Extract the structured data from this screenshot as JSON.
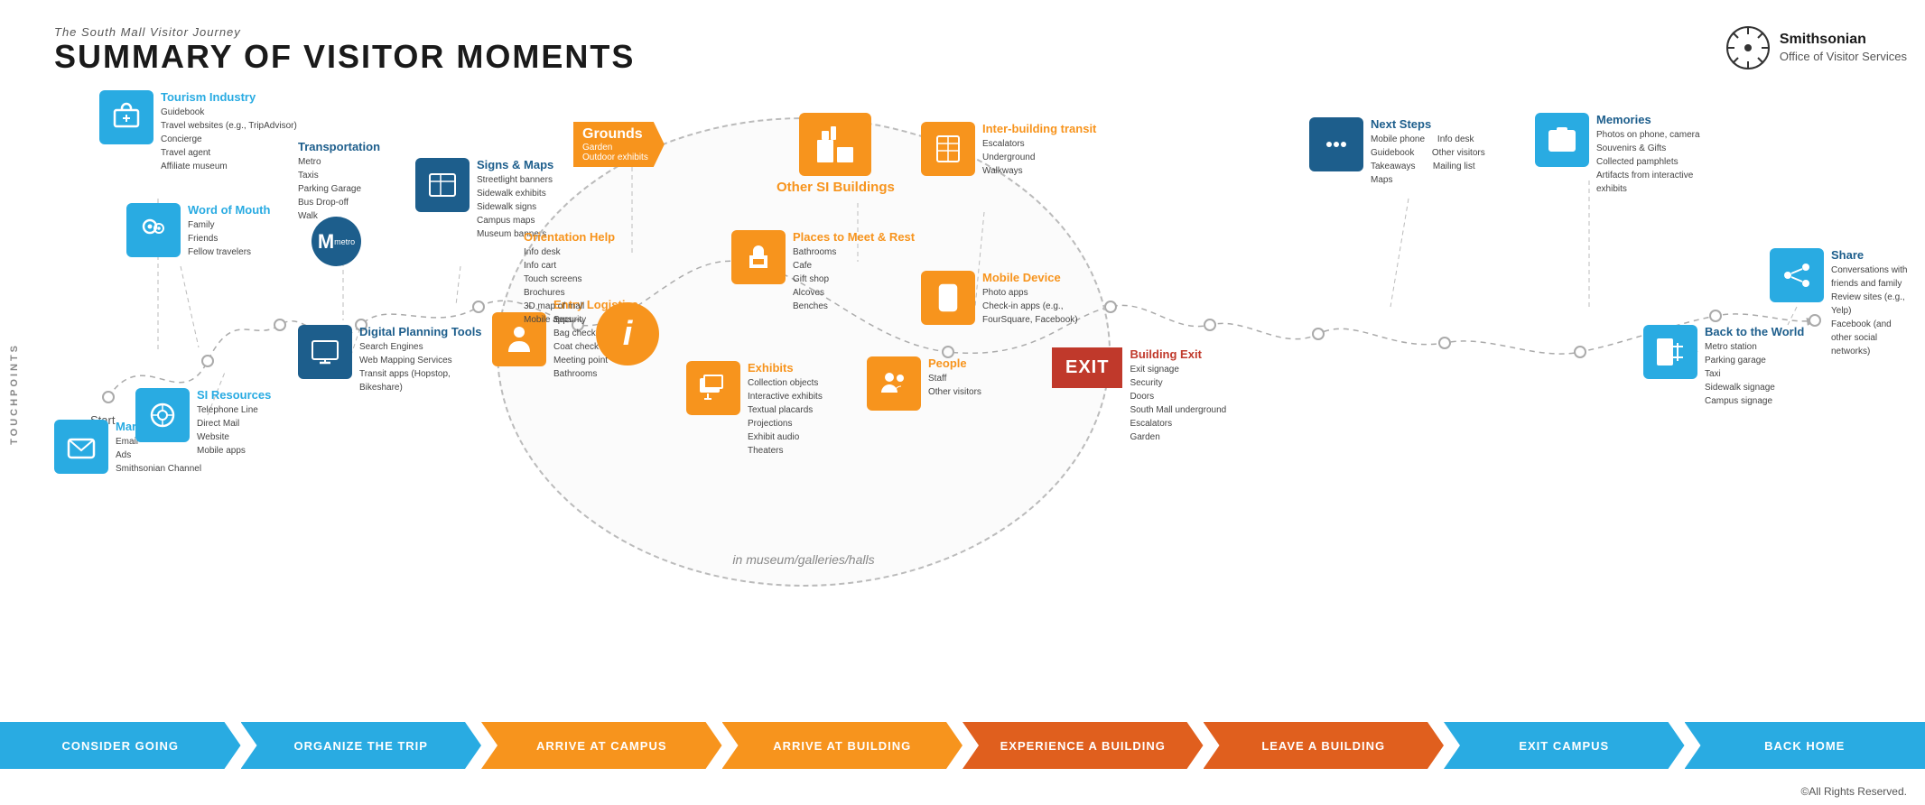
{
  "header": {
    "subtitle": "The South Mall Visitor Journey",
    "title": "SUMMARY OF VISITOR MOMENTS"
  },
  "smithsonian": {
    "name": "Smithsonian",
    "dept": "Office of Visitor Services"
  },
  "copyright": "©All Rights Reserved.",
  "touchpoints_label": "TOUCHPOINTS",
  "central_label": "in museum/galleries/halls",
  "boxes": {
    "tourism": {
      "title": "Tourism Industry",
      "items": [
        "Guidebook",
        "Travel websites (e.g., TripAdvisor)",
        "Concierge",
        "Travel agent",
        "Affiliate museum"
      ]
    },
    "word_of_mouth": {
      "title": "Word of Mouth",
      "items": [
        "Family",
        "Friends",
        "Fellow travelers"
      ]
    },
    "marketing": {
      "title": "Marketing",
      "items": [
        "Email",
        "Ads",
        "Smithsonian Channel"
      ]
    },
    "si_resources": {
      "title": "SI Resources",
      "items": [
        "Telephone Line",
        "Direct Mail",
        "Website",
        "Mobile apps"
      ]
    },
    "transportation": {
      "title": "Transportation",
      "items": [
        "Metro",
        "Taxis",
        "Parking Garage",
        "Bus Drop-off",
        "Walk"
      ]
    },
    "signs_maps": {
      "title": "Signs & Maps",
      "items": [
        "Streetlight banners",
        "Sidewalk exhibits",
        "Sidewalk signs",
        "Campus maps",
        "Museum banners"
      ]
    },
    "digital_planning": {
      "title": "Digital Planning Tools",
      "items": [
        "Search Engines",
        "Web Mapping Services",
        "Transit apps (Hopstop, Bikeshare)"
      ]
    },
    "grounds": {
      "title": "Grounds",
      "items": [
        "Garden",
        "Outdoor exhibits"
      ]
    },
    "entry_logistics": {
      "title": "Entry Logistics",
      "items": [
        "Security",
        "Bag check",
        "Coat check",
        "Meeting point",
        "Bathrooms"
      ]
    },
    "orientation_help": {
      "title": "Orientation Help",
      "items": [
        "Info desk",
        "Info cart",
        "Touch screens",
        "Brochures",
        "3D map of mall",
        "Mobile apps"
      ]
    },
    "places_meet_rest": {
      "title": "Places to Meet & Rest",
      "items": [
        "Bathrooms",
        "Cafe",
        "Gift shop",
        "Alcoves",
        "Benches"
      ]
    },
    "exhibits": {
      "title": "Exhibits",
      "items": [
        "Collection objects",
        "Interactive exhibits",
        "Textual placards",
        "Projections",
        "Exhibit audio",
        "Theaters"
      ]
    },
    "people": {
      "title": "People",
      "items": [
        "Staff",
        "Other visitors"
      ]
    },
    "mobile_device": {
      "title": "Mobile Device",
      "items": [
        "Photo apps",
        "Check-in apps (e.g., FourSquare, Facebook)"
      ]
    },
    "other_si_buildings": {
      "title": "Other SI Buildings",
      "items": []
    },
    "inter_building_transit": {
      "title": "Inter-building transit",
      "items": [
        "Escalators",
        "Underground",
        "Walkways"
      ]
    },
    "building_exit": {
      "title": "Building Exit",
      "items": [
        "Exit signage",
        "Security",
        "Doors",
        "South Mall underground",
        "Escalators",
        "Garden"
      ]
    },
    "next_steps": {
      "title": "Next Steps",
      "items": [
        "Mobile phone",
        "Info desk",
        "Guidebook",
        "Other visitors",
        "Takeaways",
        "Mailing list",
        "Maps"
      ]
    },
    "memories": {
      "title": "Memories",
      "items": [
        "Photos on phone, camera",
        "Souvenirs & Gifts",
        "Collected pamphlets",
        "Artifacts from interactive exhibits"
      ]
    },
    "back_to_world": {
      "title": "Back to the World",
      "items": [
        "Metro station",
        "Parking garage",
        "Taxi",
        "Sidewalk signage",
        "Campus signage"
      ]
    },
    "share": {
      "title": "Share",
      "items": [
        "Conversations with friends and family",
        "Review sites (e.g., Yelp)",
        "Facebook (and other social networks)"
      ]
    }
  },
  "bottom_steps": [
    {
      "label": "CONSIDER GOING",
      "color": "blue"
    },
    {
      "label": "ORGANIZE THE TRIP",
      "color": "blue"
    },
    {
      "label": "ARRIVE AT CAMPUS",
      "color": "orange"
    },
    {
      "label": "ARRIVE AT BUILDING",
      "color": "orange"
    },
    {
      "label": "EXPERIENCE A BUILDING",
      "color": "darkorange"
    },
    {
      "label": "LEAVE A BUILDING",
      "color": "darkorange"
    },
    {
      "label": "EXIT CAMPUS",
      "color": "blue"
    },
    {
      "label": "BACK HOME",
      "color": "blue"
    }
  ]
}
